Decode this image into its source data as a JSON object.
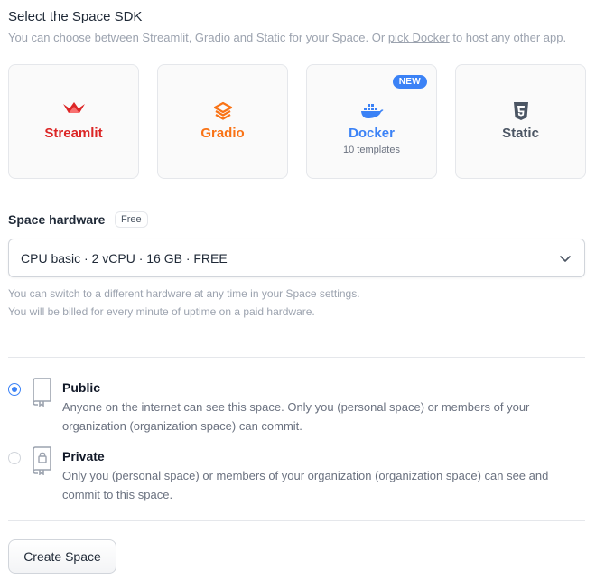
{
  "sdk": {
    "title": "Select the Space SDK",
    "description_before": "You can choose between Streamlit, Gradio and Static for your Space. Or ",
    "description_link": "pick Docker",
    "description_after": " to host any other app.",
    "options": [
      {
        "name": "Streamlit",
        "icon": "streamlit-crown-icon",
        "color": "#dc2626"
      },
      {
        "name": "Gradio",
        "icon": "gradio-icon",
        "color": "#f97316"
      },
      {
        "name": "Docker",
        "icon": "docker-whale-icon",
        "color": "#3b82f6",
        "sub": "10 templates",
        "badge": "NEW"
      },
      {
        "name": "Static",
        "icon": "html5-icon",
        "color": "#4b5563"
      }
    ]
  },
  "hardware": {
    "title": "Space hardware",
    "badge": "Free",
    "selected": "CPU basic · 2 vCPU · 16 GB · FREE",
    "note_1": "You can switch to a different hardware at any time in your Space settings.",
    "note_2": "You will be billed for every minute of uptime on a paid hardware."
  },
  "visibility": {
    "public": {
      "label": "Public",
      "desc": "Anyone on the internet can see this space. Only you (personal space) or members of your organization (organization space) can commit.",
      "checked": true
    },
    "private": {
      "label": "Private",
      "desc": "Only you (personal space) or members of your organization (organization space) can see and commit to this space.",
      "checked": false
    }
  },
  "create_button": "Create Space"
}
